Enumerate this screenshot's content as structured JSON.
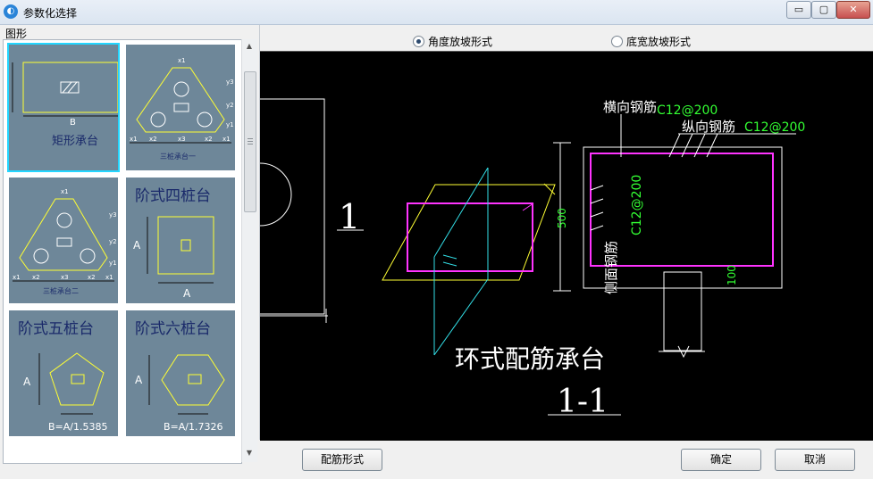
{
  "window": {
    "title": "参数化选择",
    "icon": "app-icon",
    "controls": {
      "minimize": "▭",
      "restore": "▢",
      "close": "✕"
    }
  },
  "left_panel": {
    "label": "图形",
    "thumbnails": [
      {
        "title": "矩形承台",
        "dim_b": "B",
        "selected": true
      },
      {
        "title": "三桩承台一",
        "dims": [
          "x1",
          "x2",
          "x3",
          "x2",
          "x1"
        ],
        "top_dim": "x1",
        "side_dims": [
          "y3",
          "y2",
          "y1"
        ]
      },
      {
        "title": "三桩承台二",
        "top_dim": "x1",
        "dims": [
          "x1",
          "x2",
          "x3",
          "x2",
          "x1"
        ],
        "side_dims": [
          "y3",
          "y2",
          "y1"
        ]
      },
      {
        "title": "阶式四桩台",
        "dim_a_side": "A",
        "dim_a_bottom": "A"
      },
      {
        "title": "阶式五桩台",
        "dim_a": "A",
        "formula": "B=A/1.5385"
      },
      {
        "title": "阶式六桩台",
        "dim_a": "A",
        "formula": "B=A/1.7326"
      }
    ]
  },
  "options": {
    "angle": {
      "label": "角度放坡形式",
      "checked": true
    },
    "width": {
      "label": "底宽放坡形式",
      "checked": false
    }
  },
  "drawing": {
    "label_1": "1",
    "heading": "环式配筋承台",
    "section": "1-1",
    "rebar_h_label": "横向钢筋",
    "rebar_h_spec": "C12@200",
    "rebar_l_label": "纵向钢筋",
    "rebar_l_spec": "C12@200",
    "rebar_s_label": "侧面钢筋",
    "rebar_s_spec": "C12@200",
    "dim_500": "500",
    "dim_100": "100",
    "colors": {
      "yellow": "#ffff33",
      "magenta": "#ff33ff",
      "cyan": "#33e0e8",
      "green": "#33ff33",
      "white": "#ffffff"
    }
  },
  "buttons": {
    "rebar_form": "配筋形式",
    "ok": "确定",
    "cancel": "取消"
  }
}
